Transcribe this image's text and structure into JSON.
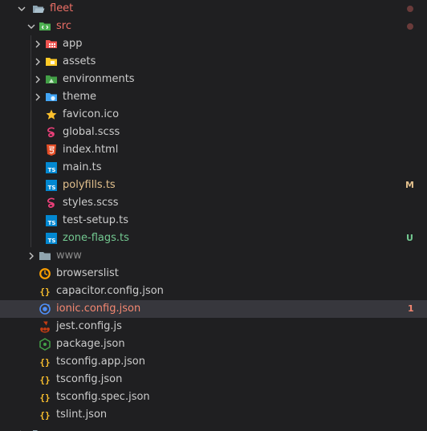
{
  "colors": {
    "folder_label": "#ec6f66",
    "modified": "#e2c08d",
    "untracked": "#73c991",
    "error": "#f48771",
    "default_text": "#cccccc",
    "muted_text": "#8b8b8b",
    "selected_bg": "#37373d",
    "dot_modified": "#6a3b3a"
  },
  "tree": {
    "fleet": {
      "label": "fleet",
      "icon": "folder-open-icon"
    },
    "src": {
      "label": "src",
      "icon": "source-folder-icon"
    },
    "app": {
      "label": "app",
      "icon": "app-folder-icon"
    },
    "assets": {
      "label": "assets",
      "icon": "assets-folder-icon"
    },
    "environments": {
      "label": "environments",
      "icon": "environments-folder-icon"
    },
    "theme": {
      "label": "theme",
      "icon": "theme-folder-icon"
    },
    "favicon": {
      "label": "favicon.ico",
      "icon": "star-icon"
    },
    "global_scss": {
      "label": "global.scss",
      "icon": "sass-icon"
    },
    "index_html": {
      "label": "index.html",
      "icon": "html5-icon"
    },
    "main_ts": {
      "label": "main.ts",
      "icon": "typescript-icon"
    },
    "polyfills_ts": {
      "label": "polyfills.ts",
      "icon": "typescript-icon",
      "badge": "M"
    },
    "styles_scss": {
      "label": "styles.scss",
      "icon": "sass-icon"
    },
    "test_setup_ts": {
      "label": "test-setup.ts",
      "icon": "typescript-icon"
    },
    "zone_flags_ts": {
      "label": "zone-flags.ts",
      "icon": "typescript-icon",
      "badge": "U"
    },
    "www": {
      "label": "www",
      "icon": "folder-icon"
    },
    "browserslist": {
      "label": "browserslist",
      "icon": "browserslist-icon"
    },
    "capacitor_config": {
      "label": "capacitor.config.json",
      "icon": "json-icon"
    },
    "ionic_config": {
      "label": "ionic.config.json",
      "icon": "ionic-icon",
      "badge": "1"
    },
    "jest_config": {
      "label": "jest.config.js",
      "icon": "jest-icon"
    },
    "package_json": {
      "label": "package.json",
      "icon": "nodejs-icon"
    },
    "tsconfig_app": {
      "label": "tsconfig.app.json",
      "icon": "json-icon"
    },
    "tsconfig_json": {
      "label": "tsconfig.json",
      "icon": "json-icon"
    },
    "tsconfig_spec": {
      "label": "tsconfig.spec.json",
      "icon": "json-icon"
    },
    "tslint_json": {
      "label": "tslint.json",
      "icon": "json-icon"
    }
  }
}
